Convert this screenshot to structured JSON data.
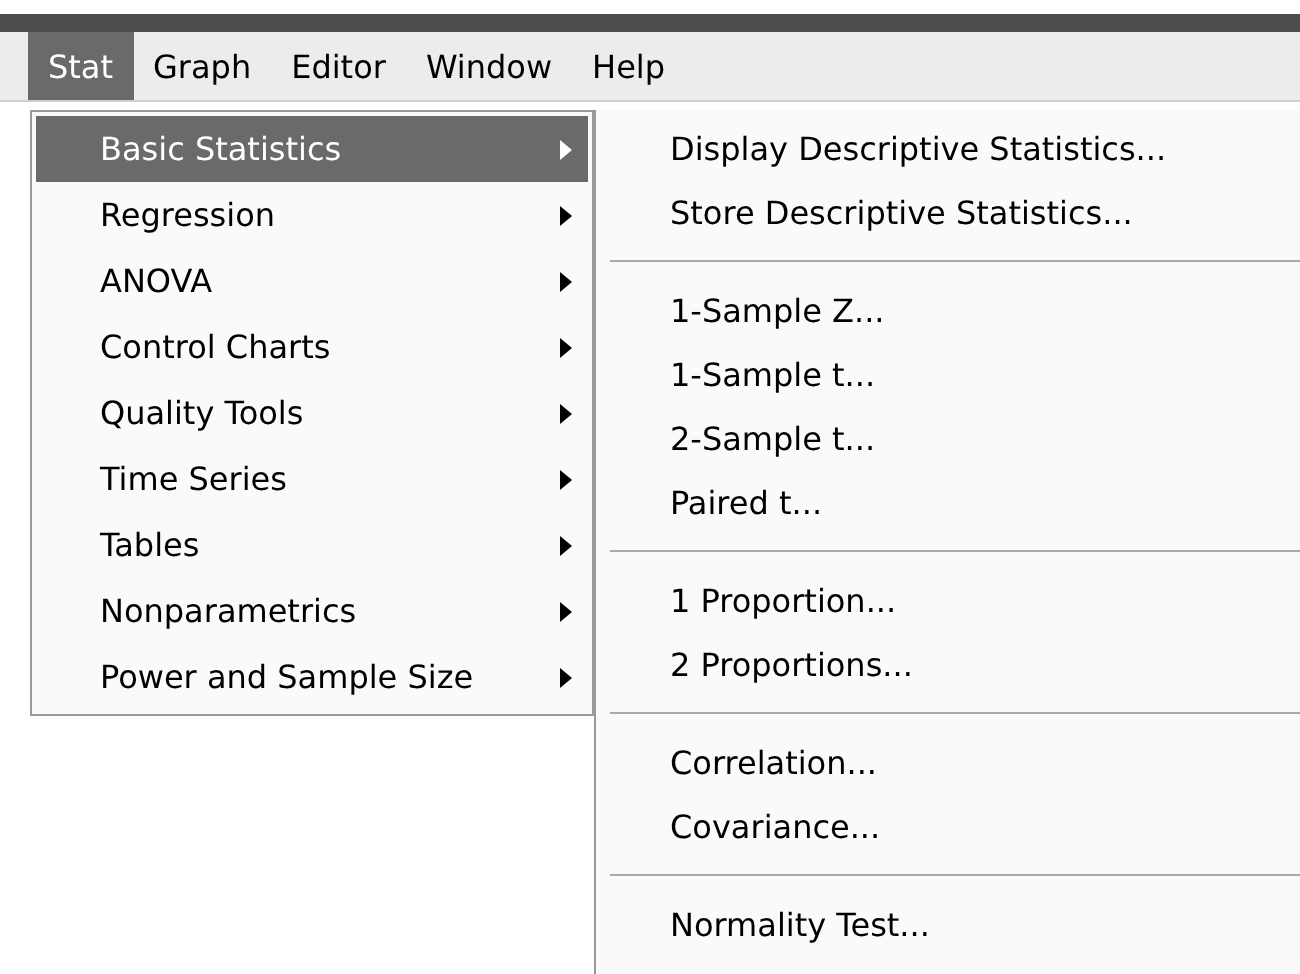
{
  "menubar": [
    {
      "label": "Stat",
      "selected": true
    },
    {
      "label": "Graph",
      "selected": false
    },
    {
      "label": "Editor",
      "selected": false
    },
    {
      "label": "Window",
      "selected": false
    },
    {
      "label": "Help",
      "selected": false
    }
  ],
  "stat_menu": [
    {
      "label": "Basic Statistics",
      "selected": true,
      "has_submenu": true
    },
    {
      "label": "Regression",
      "selected": false,
      "has_submenu": true
    },
    {
      "label": "ANOVA",
      "selected": false,
      "has_submenu": true
    },
    {
      "label": "Control Charts",
      "selected": false,
      "has_submenu": true
    },
    {
      "label": "Quality Tools",
      "selected": false,
      "has_submenu": true
    },
    {
      "label": "Time Series",
      "selected": false,
      "has_submenu": true
    },
    {
      "label": "Tables",
      "selected": false,
      "has_submenu": true
    },
    {
      "label": "Nonparametrics",
      "selected": false,
      "has_submenu": true
    },
    {
      "label": "Power and Sample Size",
      "selected": false,
      "has_submenu": true
    }
  ],
  "basic_statistics_submenu": [
    [
      "Display Descriptive Statistics...",
      "Store Descriptive Statistics..."
    ],
    [
      "1-Sample Z...",
      "1-Sample t...",
      "2-Sample t...",
      "Paired t..."
    ],
    [
      "1 Proportion...",
      "2 Proportions..."
    ],
    [
      "Correlation...",
      "Covariance..."
    ],
    [
      "Normality Test..."
    ]
  ]
}
